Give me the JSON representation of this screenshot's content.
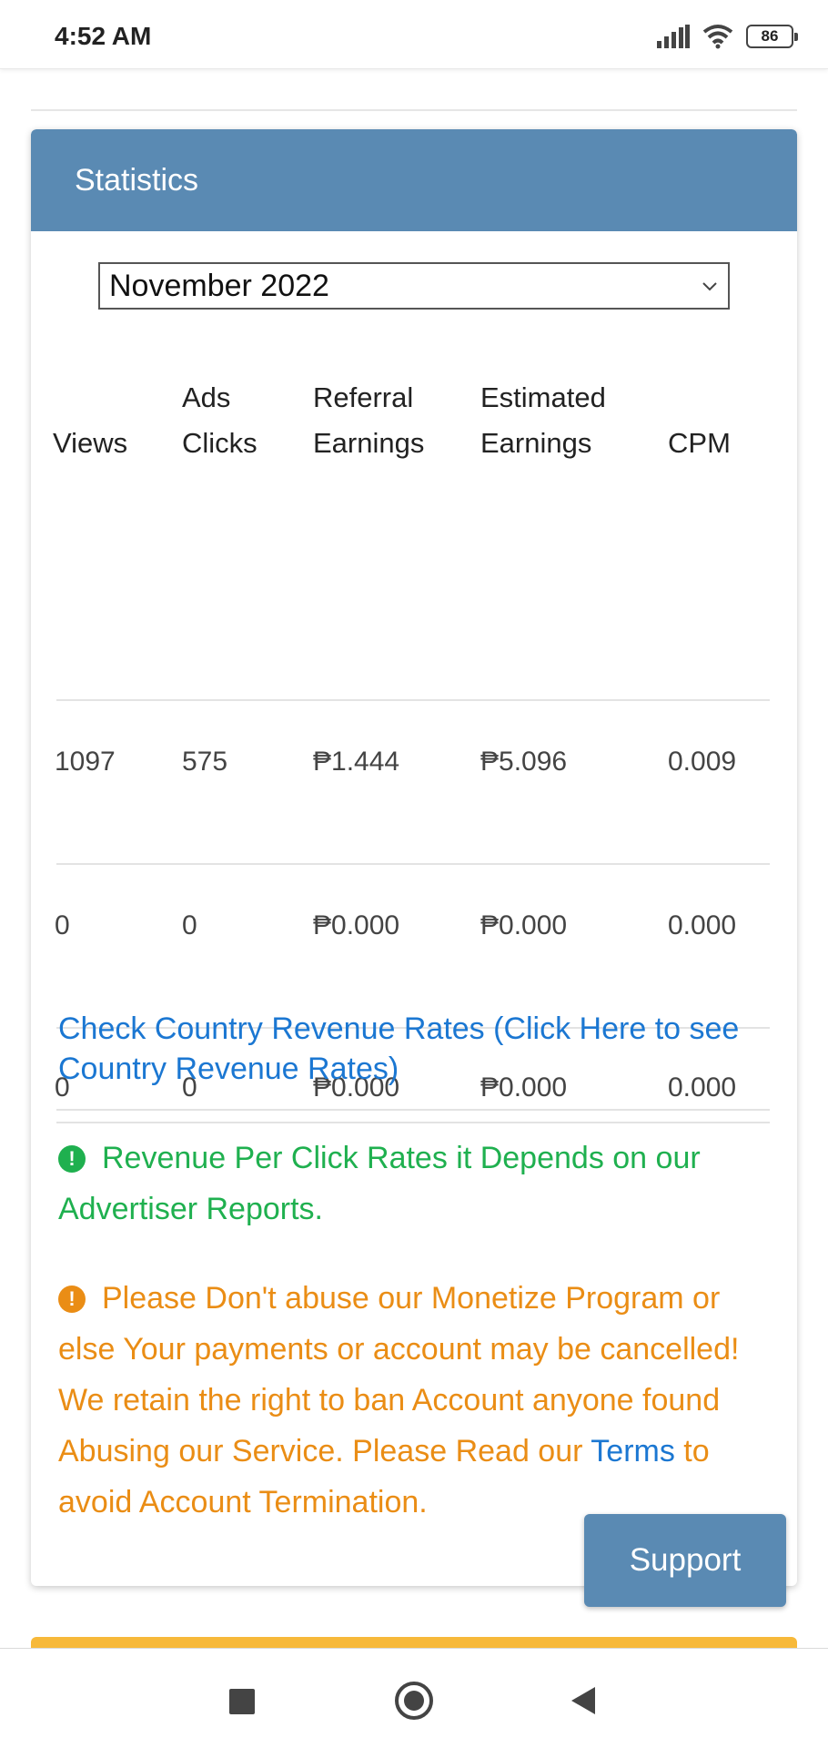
{
  "status_bar": {
    "time": "4:52 AM",
    "battery": "86"
  },
  "card": {
    "title": "Statistics",
    "month_select": {
      "value": "November 2022"
    },
    "table": {
      "headers": [
        {
          "line1": "",
          "line2": "Views"
        },
        {
          "line1": "Ads",
          "line2": "Clicks"
        },
        {
          "line1": "Referral",
          "line2": "Earnings"
        },
        {
          "line1": "Estimated",
          "line2": "Earnings"
        },
        {
          "line1": "",
          "line2": "CPM"
        }
      ],
      "rows": [
        [
          "1097",
          "575",
          "₱1.444",
          "₱5.096",
          "0.009"
        ],
        [
          "0",
          "0",
          "₱0.000",
          "₱0.000",
          "0.000"
        ],
        [
          "0",
          "0",
          "₱0.000",
          "₱0.000",
          "0.000"
        ]
      ]
    },
    "country_rates_link": "Check Country Revenue Rates (Click Here to see Country Revenue Rates)",
    "notice_green": "Revenue Per Click Rates it Depends on our Advertiser Reports.",
    "notice_orange_before": "Please Don't abuse our Monetize Program or else Your payments or account may be cancelled! We retain the right to ban Account anyone found Abusing our Service. Please Read our ",
    "terms_link": "Terms",
    "notice_orange_after": " to avoid Account Termination."
  },
  "support_button": "Support",
  "colors": {
    "header_bg": "#5a8ab3",
    "link": "#1b77d2",
    "success": "#1fb04f",
    "warning": "#ea8d15",
    "strip": "#f7b93a"
  }
}
